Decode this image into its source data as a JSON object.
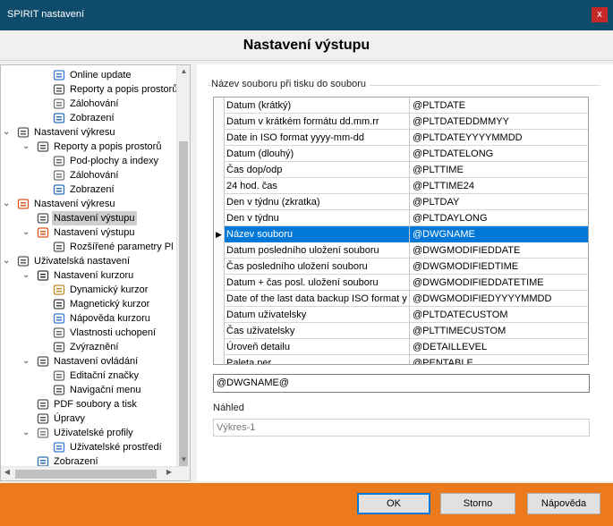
{
  "window": {
    "title": "SPIRIT nastavení",
    "close_glyph": "x"
  },
  "page_title": "Nastavení výstupu",
  "tree": [
    {
      "label": "Online update",
      "level": 3,
      "icon": "refresh-icon",
      "expander": ""
    },
    {
      "label": "Reporty a popis prostorů",
      "level": 3,
      "icon": "table-icon",
      "expander": ""
    },
    {
      "label": "Zálohování",
      "level": 3,
      "icon": "database-icon",
      "expander": ""
    },
    {
      "label": "Zobrazení",
      "level": 3,
      "icon": "monitor-icon",
      "expander": ""
    },
    {
      "label": "Nastavení výkresu",
      "level": 1,
      "icon": "gear-icon",
      "expander": "⌄"
    },
    {
      "label": "Reporty a popis prostorů",
      "level": 2,
      "icon": "table-icon",
      "expander": "⌄"
    },
    {
      "label": "Pod-plochy a indexy",
      "level": 3,
      "icon": "sub-area-icon",
      "expander": ""
    },
    {
      "label": "Zálohování",
      "level": 3,
      "icon": "database-icon",
      "expander": ""
    },
    {
      "label": "Zobrazení",
      "level": 3,
      "icon": "monitor-icon",
      "expander": ""
    },
    {
      "label": "Nastavení výkresu",
      "level": 1,
      "icon": "st-icon",
      "expander": "⌄"
    },
    {
      "label": "Nastavení výstupu",
      "level": 2,
      "icon": "printer-icon",
      "expander": "",
      "selected": true
    },
    {
      "label": "Nastavení výstupu",
      "level": 2,
      "icon": "st-icon",
      "expander": "⌄"
    },
    {
      "label": "Rozšířené parametry Pl",
      "level": 3,
      "icon": "printer-icon",
      "expander": ""
    },
    {
      "label": "Uživatelská nastavení",
      "level": 1,
      "icon": "gear-icon",
      "expander": "⌄"
    },
    {
      "label": "Nastavení kurzoru",
      "level": 2,
      "icon": "cursor-icon",
      "expander": "⌄"
    },
    {
      "label": "Dynamický kurzor",
      "level": 3,
      "icon": "pen-icon",
      "expander": ""
    },
    {
      "label": "Magnetický kurzor",
      "level": 3,
      "icon": "magnet-icon",
      "expander": ""
    },
    {
      "label": "Nápověda kurzoru",
      "level": 3,
      "icon": "bubble-icon",
      "expander": ""
    },
    {
      "label": "Vlastnosti uchopení",
      "level": 3,
      "icon": "snap-icon",
      "expander": ""
    },
    {
      "label": "Zvýraznění",
      "level": 3,
      "icon": "highlight-icon",
      "expander": ""
    },
    {
      "label": "Nastavení ovládání",
      "level": 2,
      "icon": "mouse-icon",
      "expander": "⌄"
    },
    {
      "label": "Editační značky",
      "level": 3,
      "icon": "edit-marks-icon",
      "expander": ""
    },
    {
      "label": "Navigační menu",
      "level": 3,
      "icon": "menu-icon",
      "expander": ""
    },
    {
      "label": "PDF soubory a tisk",
      "level": 2,
      "icon": "pdf-icon",
      "expander": ""
    },
    {
      "label": "Úpravy",
      "level": 2,
      "icon": "pencil-icon",
      "expander": ""
    },
    {
      "label": "Uživatelské profily",
      "level": 2,
      "icon": "users-icon",
      "expander": "⌄"
    },
    {
      "label": "Uživatelské prostředí",
      "level": 3,
      "icon": "user-card-icon",
      "expander": ""
    },
    {
      "label": "Zobrazení",
      "level": 2,
      "icon": "monitor-icon",
      "expander": ""
    }
  ],
  "group_label": "Název souboru při tisku do souboru",
  "grid_rows": [
    {
      "name": "Datum (krátký)",
      "code": "@PLTDATE"
    },
    {
      "name": "Datum v krátkém formátu dd.mm.rr",
      "code": "@PLTDATEDDMMYY"
    },
    {
      "name": "Date in ISO format yyyy-mm-dd",
      "code": "@PLTDATEYYYYMMDD"
    },
    {
      "name": "Datum (dlouhý)",
      "code": "@PLTDATELONG"
    },
    {
      "name": "Čas dop/odp",
      "code": "@PLTTIME"
    },
    {
      "name": "24 hod. čas",
      "code": "@PLTTIME24"
    },
    {
      "name": "Den v týdnu (zkratka)",
      "code": "@PLTDAY"
    },
    {
      "name": "Den v týdnu",
      "code": "@PLTDAYLONG"
    },
    {
      "name": "Název souboru",
      "code": "@DWGNAME",
      "active": true
    },
    {
      "name": "Datum posledního uložení souboru",
      "code": "@DWGMODIFIEDDATE"
    },
    {
      "name": "Čas posledního uložení souboru",
      "code": "@DWGMODIFIEDTIME"
    },
    {
      "name": "Datum + čas posl. uložení souboru",
      "code": "@DWGMODIFIEDDATETIME"
    },
    {
      "name": "Date of the last data backup ISO format y",
      "code": "@DWGMODIFIEDYYYYMMDD"
    },
    {
      "name": "Datum uživatelsky",
      "code": "@PLTDATECUSTOM"
    },
    {
      "name": "Čas uživatelsky",
      "code": "@PLTTIMECUSTOM"
    },
    {
      "name": "Úroveň detailu",
      "code": "@DETAILLEVEL"
    },
    {
      "name": "Paleta per",
      "code": "@PENTABLE"
    }
  ],
  "row_marker": "▶",
  "filename_value": "@DWGNAME@",
  "preview_label": "Náhled",
  "preview_value": "Výkres-1",
  "buttons": {
    "ok": "OK",
    "cancel": "Storno",
    "help": "Nápověda"
  },
  "colors": {
    "titlebar": "#0f4c6b",
    "accent": "#0078d7",
    "footer": "#ec7a1c",
    "close": "#c62828"
  }
}
